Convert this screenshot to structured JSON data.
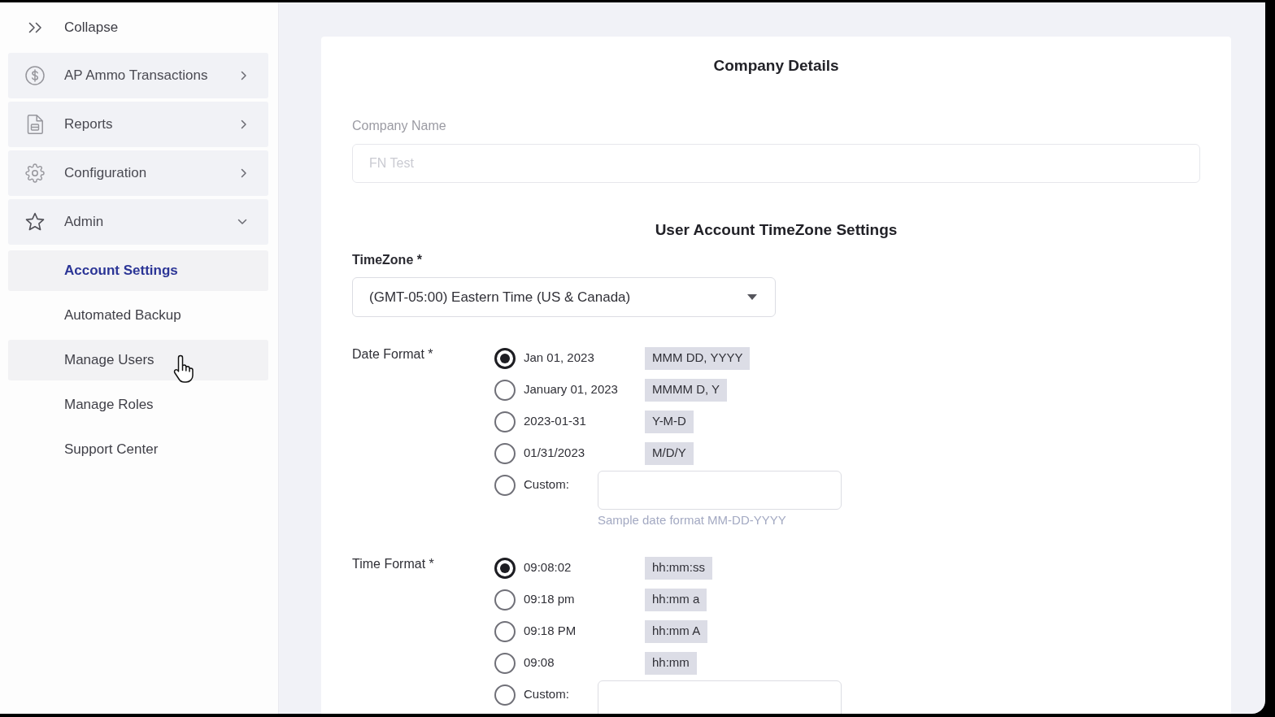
{
  "sidebar": {
    "collapse": {
      "label": "Collapse"
    },
    "items": [
      {
        "label": "AP Ammo Transactions",
        "expanded": false
      },
      {
        "label": "Reports",
        "expanded": false
      },
      {
        "label": "Configuration",
        "expanded": false
      },
      {
        "label": "Admin",
        "expanded": true,
        "children": [
          {
            "label": "Account Settings",
            "selected": true,
            "hovered": false
          },
          {
            "label": "Automated Backup",
            "selected": false,
            "hovered": false
          },
          {
            "label": "Manage Users",
            "selected": false,
            "hovered": true
          },
          {
            "label": "Manage Roles",
            "selected": false,
            "hovered": false
          },
          {
            "label": "Support Center",
            "selected": false,
            "hovered": false
          }
        ]
      }
    ]
  },
  "form": {
    "title": "Company Details",
    "company_name": {
      "label": "Company Name",
      "value": "FN Test",
      "disabled": true
    },
    "timezone_heading": "User Account TimeZone Settings",
    "timezone": {
      "label": "TimeZone *",
      "value": "(GMT-05:00) Eastern Time (US & Canada)"
    },
    "date_format": {
      "label": "Date Format *",
      "options": [
        {
          "kind": "preset",
          "label": "Jan 01, 2023",
          "format": "MMM DD, YYYY",
          "selected": true
        },
        {
          "kind": "preset",
          "label": "January 01, 2023",
          "format": "MMMM D, Y",
          "selected": false
        },
        {
          "kind": "preset",
          "label": "2023-01-31",
          "format": "Y-M-D",
          "selected": false
        },
        {
          "kind": "preset",
          "label": "01/31/2023",
          "format": "M/D/Y",
          "selected": false
        },
        {
          "kind": "custom",
          "label": "Custom:",
          "selected": false
        }
      ],
      "hint": "Sample date format MM-DD-YYYY"
    },
    "time_format": {
      "label": "Time Format *",
      "options": [
        {
          "kind": "preset",
          "label": "09:08:02",
          "format": "hh:mm:ss",
          "selected": true
        },
        {
          "kind": "preset",
          "label": "09:18 pm",
          "format": "hh:mm a",
          "selected": false
        },
        {
          "kind": "preset",
          "label": "09:18 PM",
          "format": "hh:mm A",
          "selected": false
        },
        {
          "kind": "preset",
          "label": "09:08",
          "format": "hh:mm",
          "selected": false
        },
        {
          "kind": "custom",
          "label": "Custom:",
          "selected": false
        }
      ]
    }
  }
}
